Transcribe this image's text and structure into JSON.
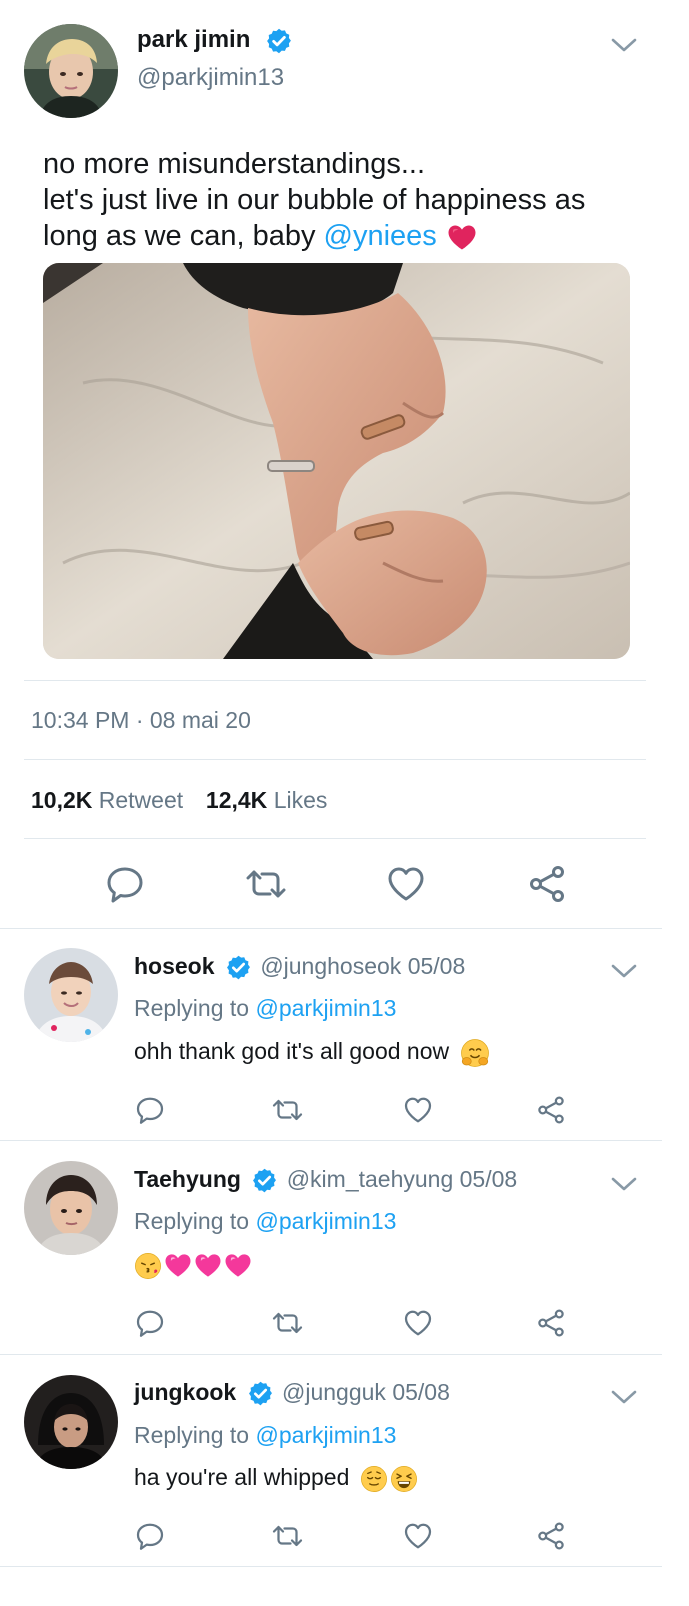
{
  "main_tweet": {
    "name": "park jimin",
    "handle": "@parkjimin13",
    "text_line1": "no more misunderstandings...",
    "text_line2": "let's just live in our bubble of happiness as",
    "text_line3_pre": "long as we can, baby ",
    "text_mention": "@yniees",
    "text_emoji": "red-heart",
    "timestamp": "10:34 PM · 08 mai 20",
    "retweets_count": "10,2K",
    "retweets_label": "Retweet",
    "likes_count": "12,4K",
    "likes_label": "Likes"
  },
  "replies": [
    {
      "name": "hoseok",
      "handle_date": "@junghoseok 05/08",
      "replying_prefix": "Replying to ",
      "replying_to": "@parkjimin13",
      "text": "ohh thank god it's all good now",
      "emojis": [
        "hugging-face"
      ]
    },
    {
      "name": "Taehyung",
      "handle_date": "@kim_taehyung 05/08",
      "replying_prefix": "Replying to ",
      "replying_to": "@parkjimin13",
      "text": "",
      "emojis": [
        "kissing-face",
        "pink-heart",
        "pink-heart",
        "pink-heart"
      ]
    },
    {
      "name": "jungkook",
      "handle_date": "@jungguk 05/08",
      "replying_prefix": "Replying to ",
      "replying_to": "@parkjimin13",
      "text": "ha you're all whipped",
      "emojis": [
        "relieved-face",
        "laughing-face"
      ]
    }
  ],
  "icons": {
    "verified": "verified-badge-icon",
    "chevron": "chevron-down-icon",
    "reply": "reply-icon",
    "retweet": "retweet-icon",
    "like": "heart-icon",
    "share": "share-icon"
  },
  "colors": {
    "accent": "#1da1f2",
    "text_primary": "#14171a",
    "text_secondary": "#657786",
    "divider": "#e1e8ed",
    "icon": "#657786"
  }
}
